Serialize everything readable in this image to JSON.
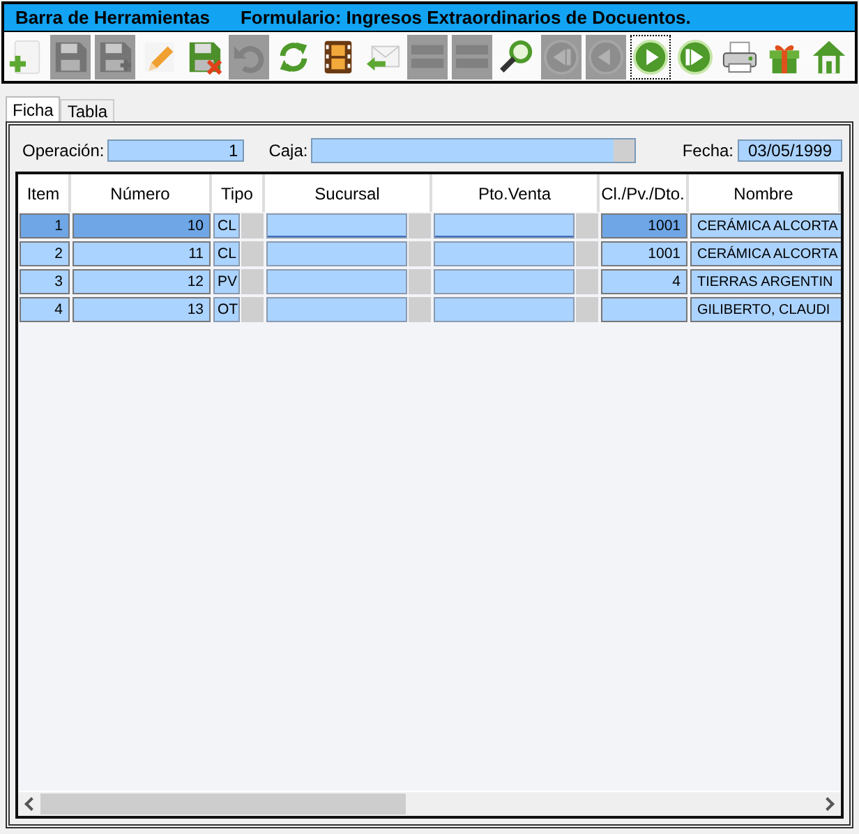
{
  "title_bar": {
    "app": "Barra de Herramientas",
    "form": "Formulario: Ingresos Extraordinarios de Docuentos."
  },
  "toolbar": [
    {
      "kind": "new",
      "disabled": false,
      "focused": false
    },
    {
      "kind": "save",
      "disabled": true,
      "focused": false
    },
    {
      "kind": "save-as",
      "disabled": true,
      "focused": false
    },
    {
      "kind": "edit",
      "disabled": false,
      "focused": false
    },
    {
      "kind": "save-cancel",
      "disabled": false,
      "focused": false
    },
    {
      "kind": "undo",
      "disabled": true,
      "focused": false
    },
    {
      "kind": "refresh",
      "disabled": false,
      "focused": false
    },
    {
      "kind": "film",
      "disabled": false,
      "focused": false
    },
    {
      "kind": "reply",
      "disabled": false,
      "focused": false
    },
    {
      "kind": "insert-row",
      "disabled": true,
      "focused": false
    },
    {
      "kind": "delete-row",
      "disabled": true,
      "focused": false
    },
    {
      "kind": "search",
      "disabled": false,
      "focused": false
    },
    {
      "kind": "first",
      "disabled": true,
      "focused": false
    },
    {
      "kind": "previous",
      "disabled": true,
      "focused": false
    },
    {
      "kind": "next",
      "disabled": false,
      "focused": true
    },
    {
      "kind": "last",
      "disabled": false,
      "focused": false
    },
    {
      "kind": "print",
      "disabled": false,
      "focused": false
    },
    {
      "kind": "gift",
      "disabled": false,
      "focused": false
    },
    {
      "kind": "home",
      "disabled": false,
      "focused": false
    }
  ],
  "tabs": [
    {
      "label": "Ficha",
      "selected": true
    },
    {
      "label": "Tabla",
      "selected": false
    }
  ],
  "form": {
    "operacion_label": "Operación:",
    "operacion": "1",
    "caja_label": "Caja:",
    "fecha_label": "Fecha:",
    "fecha": "03/05/1999"
  },
  "table": {
    "columns": [
      "Item",
      "Número",
      "Tipo",
      "Sucursal",
      "Pto.Venta",
      "Cl./Pv./Dto.",
      "Nombre"
    ],
    "rows": [
      {
        "item": "1",
        "numero": "10",
        "tipo": "CL",
        "cl_pv_dto": "1001",
        "nombre": "CERÁMICA ALCORTA",
        "selected": true
      },
      {
        "item": "2",
        "numero": "11",
        "tipo": "CL",
        "cl_pv_dto": "1001",
        "nombre": "CERÁMICA ALCORTA",
        "selected": false
      },
      {
        "item": "3",
        "numero": "12",
        "tipo": "PV",
        "cl_pv_dto": "4",
        "nombre": "TIERRAS ARGENTIN",
        "selected": false
      },
      {
        "item": "4",
        "numero": "13",
        "tipo": "OT",
        "nombre": "GILIBERTO, CLAUDI",
        "selected": false
      }
    ]
  }
}
